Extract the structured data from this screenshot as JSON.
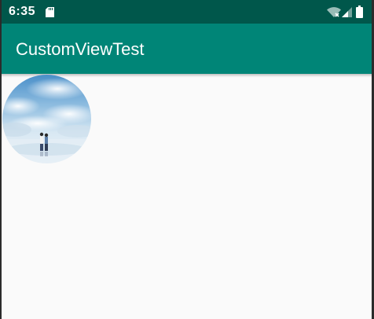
{
  "status_bar": {
    "time": "6:35",
    "icons": [
      "sd-card-icon",
      "wifi-off-icon",
      "signal-icon",
      "battery-icon"
    ],
    "background": "#00574b"
  },
  "app_bar": {
    "title": "CustomViewTest",
    "background": "#008577"
  },
  "content": {
    "background": "#fafafa",
    "image": {
      "shape": "circle",
      "description_icon": "circular-photo"
    }
  }
}
